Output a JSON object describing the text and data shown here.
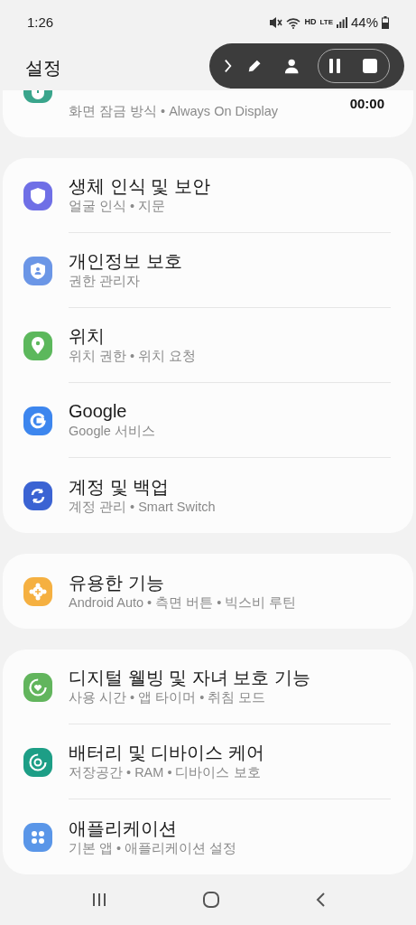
{
  "status_bar": {
    "time": "1:26",
    "network": "HD",
    "lte": "LTE",
    "battery": "44%"
  },
  "header": {
    "title": "설정"
  },
  "recorder": {
    "timer": "00:00"
  },
  "groups": [
    {
      "partial": true,
      "items": [
        {
          "kind": "lock",
          "color": "#3aa58c",
          "subtitle": "화면 잠금 방식 • Always On Display"
        }
      ]
    },
    {
      "partial": false,
      "items": [
        {
          "kind": "shield",
          "color": "#6f6fe6",
          "title": "생체 인식 및 보안",
          "subtitle": "얼굴 인식 • 지문"
        },
        {
          "kind": "privacy",
          "color": "#6b96e6",
          "title": "개인정보 보호",
          "subtitle": "권한 관리자"
        },
        {
          "kind": "pin",
          "color": "#5cb85c",
          "title": "위치",
          "subtitle": "위치 권한 • 위치 요청"
        },
        {
          "kind": "google",
          "color": "#3d86ee",
          "title": "Google",
          "subtitle": "Google 서비스"
        },
        {
          "kind": "sync",
          "color": "#3b63d3",
          "title": "계정 및 백업",
          "subtitle": "계정 관리 • Smart Switch"
        }
      ]
    },
    {
      "partial": false,
      "items": [
        {
          "kind": "puzzle",
          "color": "#f5b041",
          "title": "유용한 기능",
          "subtitle": "Android Auto • 측면 버튼 • 빅스비 루틴"
        }
      ]
    },
    {
      "partial": false,
      "items": [
        {
          "kind": "wellbeing",
          "color": "#62b55d",
          "title": "디지털 웰빙 및 자녀 보호 기능",
          "subtitle": "사용 시간 • 앱 타이머 • 취침 모드"
        },
        {
          "kind": "care",
          "color": "#1d9e86",
          "title": "배터리 및 디바이스 케어",
          "subtitle": "저장공간 • RAM • 디바이스 보호"
        },
        {
          "kind": "apps",
          "color": "#5a96e8",
          "title": "애플리케이션",
          "subtitle": "기본 앱 • 애플리케이션 설정"
        }
      ]
    }
  ]
}
